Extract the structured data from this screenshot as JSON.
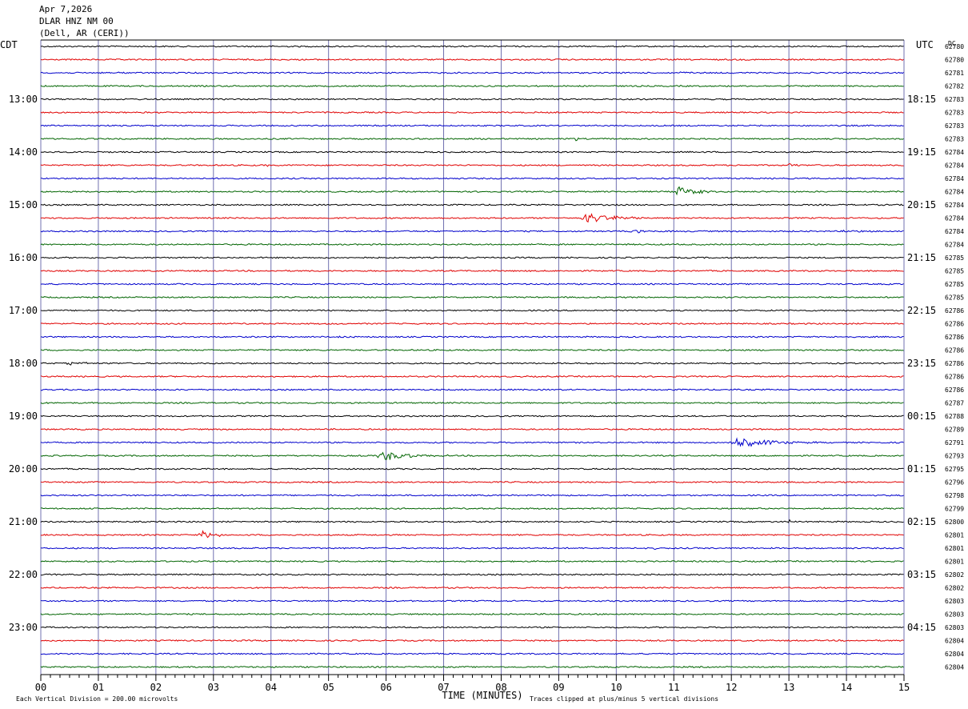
{
  "header": {
    "date": "Apr 7,2026",
    "station": "DLAR HNZ NM 00",
    "location": "(Dell, AR (CERI))"
  },
  "labels": {
    "left_timezone": "CDT",
    "right_timezone": "UTC",
    "dc_label": "DC",
    "footer_scale": "Each Vertical Division =  200.00 microvolts",
    "footer_clip": "Traces clipped at plus/minus 5 vertical divisions"
  },
  "colors": {
    "trace_cycle": [
      "#000000",
      "#e00000",
      "#0000cc",
      "#006400"
    ],
    "grid": "#808080",
    "vertical_grid": "#7070b0"
  },
  "chart_data": {
    "type": "line",
    "title": "",
    "xlabel": "TIME (MINUTES)",
    "xlim": [
      0,
      15
    ],
    "x_ticks": [
      "00",
      "01",
      "02",
      "03",
      "04",
      "05",
      "06",
      "07",
      "08",
      "09",
      "10",
      "11",
      "12",
      "13",
      "14",
      "15"
    ],
    "trace_count": 48,
    "left_hour_labels": [
      "13:00",
      "14:00",
      "15:00",
      "16:00",
      "17:00",
      "18:00",
      "19:00",
      "20:00",
      "21:00",
      "22:00",
      "23:00"
    ],
    "right_hour_labels": [
      "18:15",
      "19:15",
      "20:15",
      "21:15",
      "22:15",
      "23:15",
      "00:15",
      "01:15",
      "02:15",
      "03:15",
      "04:15"
    ],
    "hour_label_first_row": 4,
    "dc_offsets": [
      "62780",
      "62780",
      "62781",
      "62782",
      "62783",
      "62783",
      "62783",
      "62783",
      "62784",
      "62784",
      "62784",
      "62784",
      "62784",
      "62784",
      "62784",
      "62784",
      "62785",
      "62785",
      "62785",
      "62785",
      "62786",
      "62786",
      "62786",
      "62786",
      "62786",
      "62786",
      "62786",
      "62787",
      "62788",
      "62789",
      "62791",
      "62793",
      "62795",
      "62796",
      "62798",
      "62799",
      "62800",
      "62801",
      "62801",
      "62801",
      "62802",
      "62802",
      "62803",
      "62803",
      "62803",
      "62804",
      "62804",
      "62804"
    ],
    "events": [
      {
        "row": 2,
        "minute": 1.2,
        "amp": 2,
        "dur": 0.3
      },
      {
        "row": 2,
        "minute": 11.0,
        "amp": 2,
        "dur": 0.5
      },
      {
        "row": 7,
        "minute": 9.3,
        "amp": 2,
        "dur": 0.2
      },
      {
        "row": 9,
        "minute": 3.9,
        "amp": 3,
        "dur": 0.1
      },
      {
        "row": 9,
        "minute": 13.0,
        "amp": 5,
        "dur": 0.2
      },
      {
        "row": 11,
        "minute": 11.05,
        "amp": 7,
        "dur": 0.8
      },
      {
        "row": 13,
        "minute": 9.45,
        "amp": 7,
        "dur": 1.2
      },
      {
        "row": 13,
        "minute": 9.85,
        "amp": 4,
        "dur": 0.3
      },
      {
        "row": 14,
        "minute": 10.3,
        "amp": 2,
        "dur": 0.6
      },
      {
        "row": 14,
        "minute": 14.0,
        "amp": 2,
        "dur": 0.4
      },
      {
        "row": 21,
        "minute": 5.45,
        "amp": 3,
        "dur": 0.2
      },
      {
        "row": 22,
        "minute": 5.1,
        "amp": 2,
        "dur": 0.4
      },
      {
        "row": 24,
        "minute": 0.5,
        "amp": 2,
        "dur": 0.7
      },
      {
        "row": 30,
        "minute": 12.0,
        "amp": 8,
        "dur": 1.5
      },
      {
        "row": 31,
        "minute": 5.9,
        "amp": 7,
        "dur": 1.2
      },
      {
        "row": 36,
        "minute": 13.0,
        "amp": 4,
        "dur": 0.1
      },
      {
        "row": 37,
        "minute": 2.8,
        "amp": 6,
        "dur": 0.6
      },
      {
        "row": 38,
        "minute": 10.5,
        "amp": 2,
        "dur": 0.6
      },
      {
        "row": 40,
        "minute": 3.9,
        "amp": 2,
        "dur": 0.1
      }
    ]
  }
}
